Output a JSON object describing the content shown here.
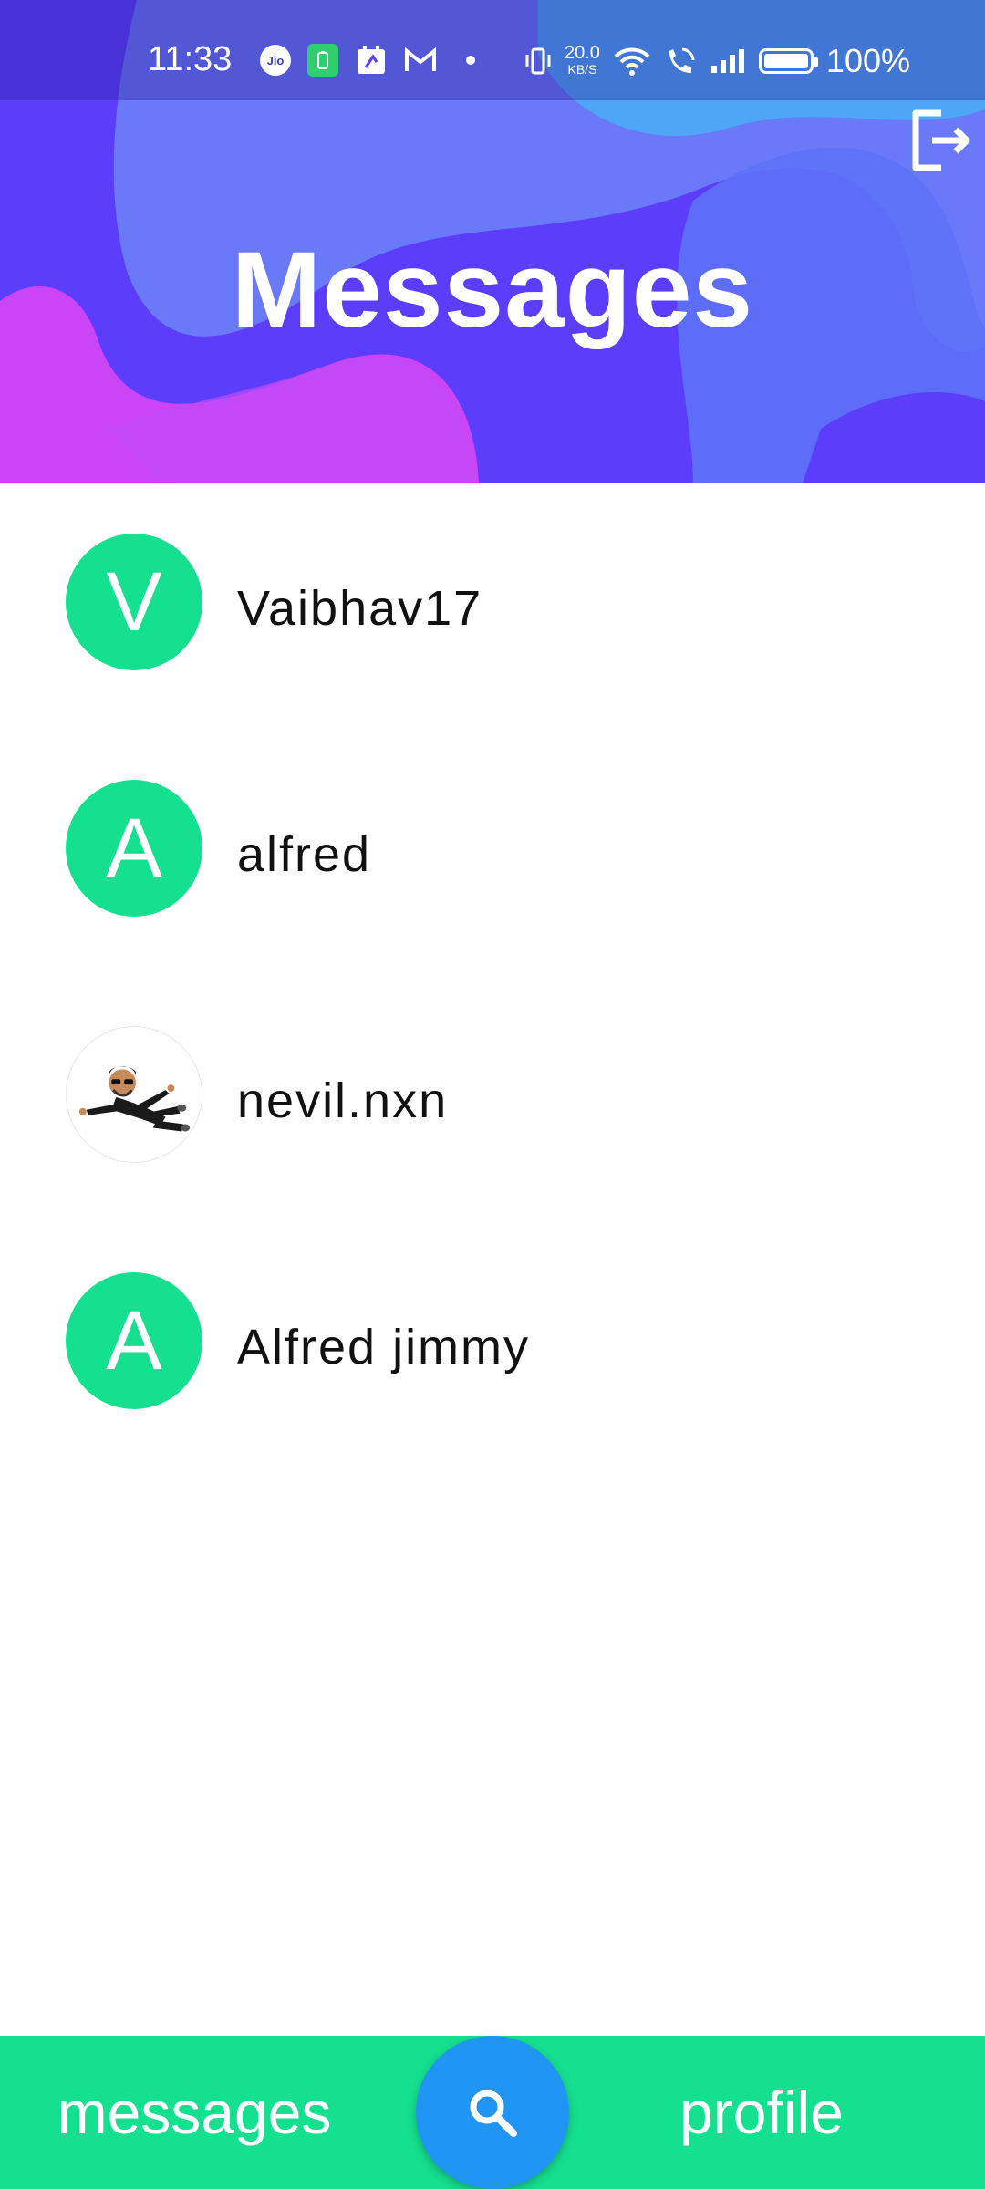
{
  "status_bar": {
    "time": "11:33",
    "carrier_icon_label": "Jio",
    "network_speed": "20.0",
    "network_speed_unit": "KB/S",
    "battery_percent": "100%"
  },
  "header": {
    "title": "Messages",
    "logout_icon": "logout-icon"
  },
  "contacts": [
    {
      "name": "Vaibhav17",
      "initial": "V",
      "avatar_type": "initial"
    },
    {
      "name": "alfred",
      "initial": "A",
      "avatar_type": "initial"
    },
    {
      "name": "nevil.nxn",
      "initial": "",
      "avatar_type": "photo"
    },
    {
      "name": "Alfred jimmy",
      "initial": "A",
      "avatar_type": "initial"
    }
  ],
  "bottom_nav": {
    "messages_label": "messages",
    "profile_label": "profile",
    "search_icon": "search-icon"
  },
  "colors": {
    "accent_green": "#15e08f",
    "header_purple": "#5b3dfb",
    "fab_blue": "#2195f3"
  }
}
